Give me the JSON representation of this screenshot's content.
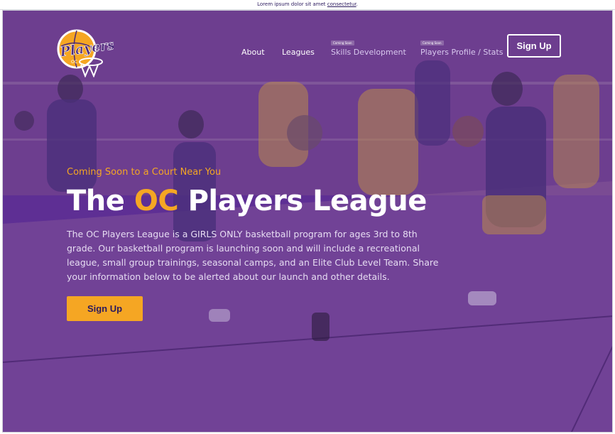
{
  "announcement": {
    "text": "Lorem ipsum dolor sit amet ",
    "link": "consectetur",
    "suffix": "."
  },
  "brand": {
    "logo_text": "Players",
    "logo_subtext": "OC"
  },
  "nav": {
    "items": [
      {
        "label": "About",
        "tag": ""
      },
      {
        "label": "Leagues",
        "tag": ""
      },
      {
        "label": "Skills Development",
        "tag": "Coming Soon"
      },
      {
        "label": "Players Profile / Stats",
        "tag": "Coming Soon"
      }
    ],
    "signup_label": "Sign Up"
  },
  "hero": {
    "subtitle": "Coming Soon to a Court Near You",
    "title_part1": "The ",
    "title_accent": "OC",
    "title_part2": " Players League",
    "description": "The OC Players League is a GIRLS ONLY basketball program for ages 3rd to 8th grade. Our basketball program is launching soon and will include a recreational league, small group trainings, seasonal camps, and an Elite Club Level Team. Share your information below to be alerted about our launch and other details.",
    "cta_label": "Sign Up"
  },
  "colors": {
    "overlay_purple": "#5e2f94",
    "accent_orange": "#f5a623",
    "text_white": "#ffffff"
  }
}
